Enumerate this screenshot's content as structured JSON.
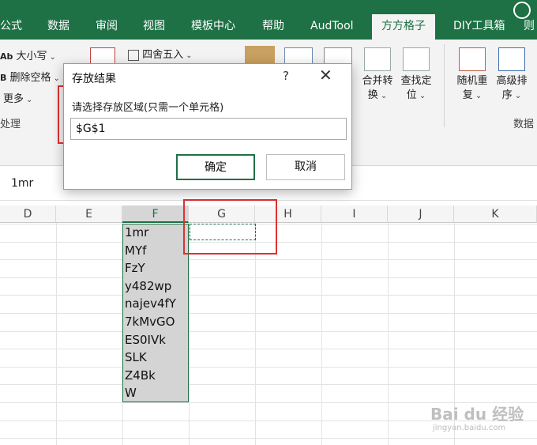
{
  "tabs": [
    {
      "label": "公式",
      "active": false
    },
    {
      "label": "数据",
      "active": false
    },
    {
      "label": "审阅",
      "active": false
    },
    {
      "label": "视图",
      "active": false
    },
    {
      "label": "模板中心",
      "active": false
    },
    {
      "label": "帮助",
      "active": false
    },
    {
      "label": "AudTool",
      "active": false
    },
    {
      "label": "方方格子",
      "active": true
    },
    {
      "label": "DIY工具箱",
      "active": false
    },
    {
      "label": "则",
      "active": false
    }
  ],
  "ribbon": {
    "text_tools": {
      "case": "大小写",
      "remove_spaces": "删除空格",
      "more": "更多",
      "group_label": "处理"
    },
    "round": "四舍五入",
    "merge_convert": {
      "line1": "合并转",
      "line2": "换"
    },
    "find_locate": {
      "line1": "查找定",
      "line2": "位"
    },
    "random_repeat": {
      "line1": "随机重",
      "line2": "复"
    },
    "advanced_sort": {
      "line1": "高级排",
      "line2": "序"
    },
    "data_group_label": "数据"
  },
  "formula_bar": {
    "value": "1mr"
  },
  "columns": [
    "D",
    "E",
    "F",
    "G",
    "H",
    "I",
    "J",
    "K"
  ],
  "selected_column": "F",
  "cells_F": [
    "1mr",
    "MYf",
    "FzY",
    "y482wp",
    "najev4fY",
    "7kMvGO",
    "ES0IVk",
    "SLK",
    "Z4Bk",
    "W"
  ],
  "dialog": {
    "title": "存放结果",
    "help": "?",
    "close": "✕",
    "prompt": "请选择存放区域(只需一个单元格)",
    "input_value": "$G$1",
    "ok_label": "确定",
    "cancel_label": "取消"
  },
  "watermark": {
    "line1": "Bai du 经验",
    "line2": "jingyan.baidu.com"
  }
}
